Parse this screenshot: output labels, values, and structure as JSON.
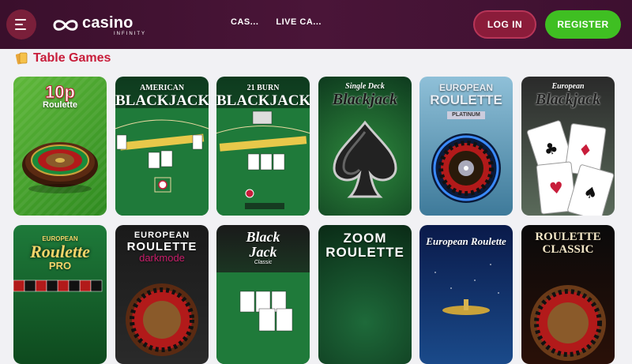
{
  "header": {
    "logo_main": "casino",
    "logo_sub": "INFINITY",
    "nav": [
      "CAS...",
      "LIVE CA..."
    ],
    "login_label": "LOG IN",
    "register_label": "REGISTER"
  },
  "section": {
    "title": "Table Games"
  },
  "games": [
    {
      "line1": "10p",
      "line2": "Roulette"
    },
    {
      "line1": "AMERICAN",
      "line2": "BLACKJACK"
    },
    {
      "line1": "21 BURN",
      "line2": "BLACKJACK"
    },
    {
      "line1": "Single Deck",
      "line2": "Blackjack"
    },
    {
      "line1": "EUROPEAN",
      "line2": "ROULETTE",
      "line3": "PLATINUM"
    },
    {
      "line1": "European",
      "line2": "Blackjack"
    },
    {
      "line1": "EUROPEAN",
      "line2": "Roulette",
      "line3": "PRO"
    },
    {
      "line1": "EUROPEAN",
      "line2": "ROULETTE",
      "line3": "darkmode"
    },
    {
      "line1": "Black",
      "line2": "Jack",
      "line3": "Classic"
    },
    {
      "line1": "ZOOM",
      "line2": "ROULETTE"
    },
    {
      "line1": "European Roulette"
    },
    {
      "line1": "ROULETTE",
      "line2": "CLASSIC"
    }
  ],
  "colors": {
    "accent": "#c81d3a",
    "register": "#3fbf22",
    "header": "#3a0f2c"
  }
}
